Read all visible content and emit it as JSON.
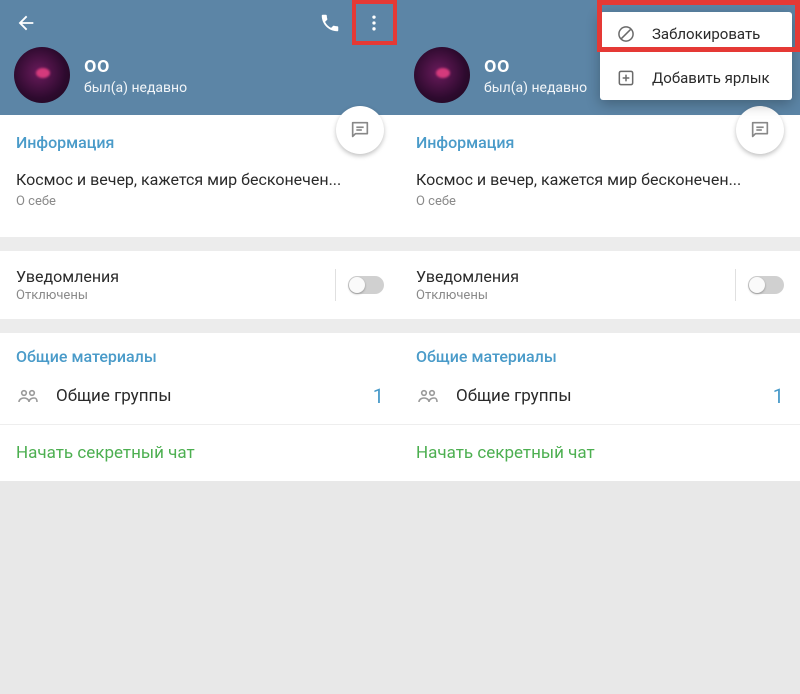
{
  "left": {
    "username": "oo",
    "status": "был(а) недавно",
    "info_title": "Информация",
    "bio": "Космос и вечер, кажется мир бесконечен...",
    "bio_label": "О себе",
    "notif_title": "Уведомления",
    "notif_sub": "Отключены",
    "shared_title": "Общие материалы",
    "groups_label": "Общие группы",
    "groups_count": "1",
    "secret_chat": "Начать секретный чат"
  },
  "right": {
    "username": "oo",
    "status": "был(а) недавно",
    "info_title": "Информация",
    "bio": "Космос и вечер, кажется мир бесконечен...",
    "bio_label": "О себе",
    "notif_title": "Уведомления",
    "notif_sub": "Отключены",
    "shared_title": "Общие материалы",
    "groups_label": "Общие группы",
    "groups_count": "1",
    "secret_chat": "Начать секретный чат",
    "menu": {
      "block": "Заблокировать",
      "shortcut": "Добавить ярлык"
    }
  }
}
